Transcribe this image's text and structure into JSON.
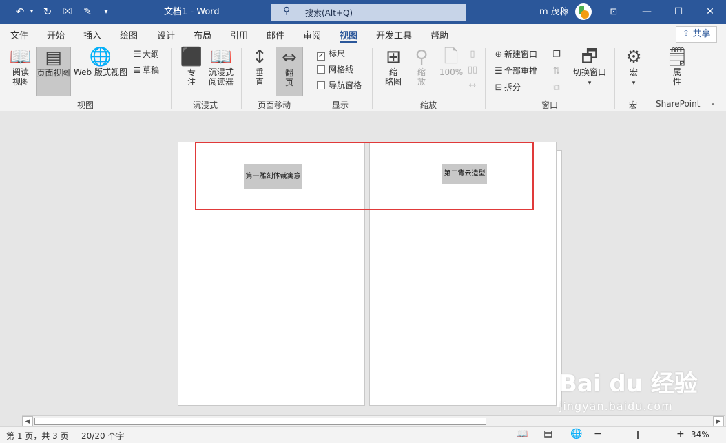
{
  "titlebar": {
    "doc_title": "文档1  -  Word",
    "search_placeholder": "搜索(Alt+Q)",
    "user_name": "m 茂稼",
    "icons": [
      "undo-icon",
      "redo-icon",
      "touch-mode-icon",
      "edit-icon",
      "customize-icon",
      "ribbon-display-icon",
      "minimize-icon",
      "maximize-icon",
      "close-icon"
    ]
  },
  "tabs": {
    "items": [
      "文件",
      "开始",
      "插入",
      "绘图",
      "设计",
      "布局",
      "引用",
      "邮件",
      "审阅",
      "视图",
      "开发工具",
      "帮助"
    ],
    "active": "视图",
    "share": "共享"
  },
  "ribbon": {
    "views": {
      "read_mode_1": "阅读",
      "read_mode_2": "视图",
      "print_layout": "页面视图",
      "web_layout": "Web 版式视图",
      "outline": "大纲",
      "draft": "草稿",
      "label": "视图"
    },
    "immersive": {
      "focus_1": "专",
      "focus_2": "注",
      "reader_1": "沉浸式",
      "reader_2": "阅读器",
      "label": "沉浸式"
    },
    "page_movement": {
      "vertical_1": "垂",
      "vertical_2": "直",
      "side_1": "翻",
      "side_2": "页",
      "label": "页面移动"
    },
    "show": {
      "ruler": "标尺",
      "ruler_checked": true,
      "gridlines": "网格线",
      "nav_pane": "导航窗格",
      "label": "显示"
    },
    "zoom": {
      "thumbnails_1": "缩",
      "thumbnails_2": "略图",
      "zoom_1": "缩",
      "zoom_2": "放",
      "percent": "100%",
      "label": "缩放"
    },
    "window": {
      "new_window": "新建窗口",
      "arrange_all": "全部重排",
      "split": "拆分",
      "switch_window": "切换窗口",
      "label": "窗口"
    },
    "macros": {
      "macros": "宏",
      "label": "宏"
    },
    "sharepoint": {
      "properties_1": "属",
      "properties_2": "性",
      "label": "SharePoint"
    }
  },
  "document": {
    "page1_heading": "第一雕刻体裁寓意",
    "page2_heading": "第二背云造型"
  },
  "watermark": {
    "main": "Bai du 经验",
    "url": "jingyan.baidu.com"
  },
  "statusbar": {
    "page_info": "第 1 页，共 3 页",
    "word_count": "20/20 个字",
    "zoom_minus": "−",
    "zoom_plus": "+",
    "zoom_level": "34%"
  }
}
